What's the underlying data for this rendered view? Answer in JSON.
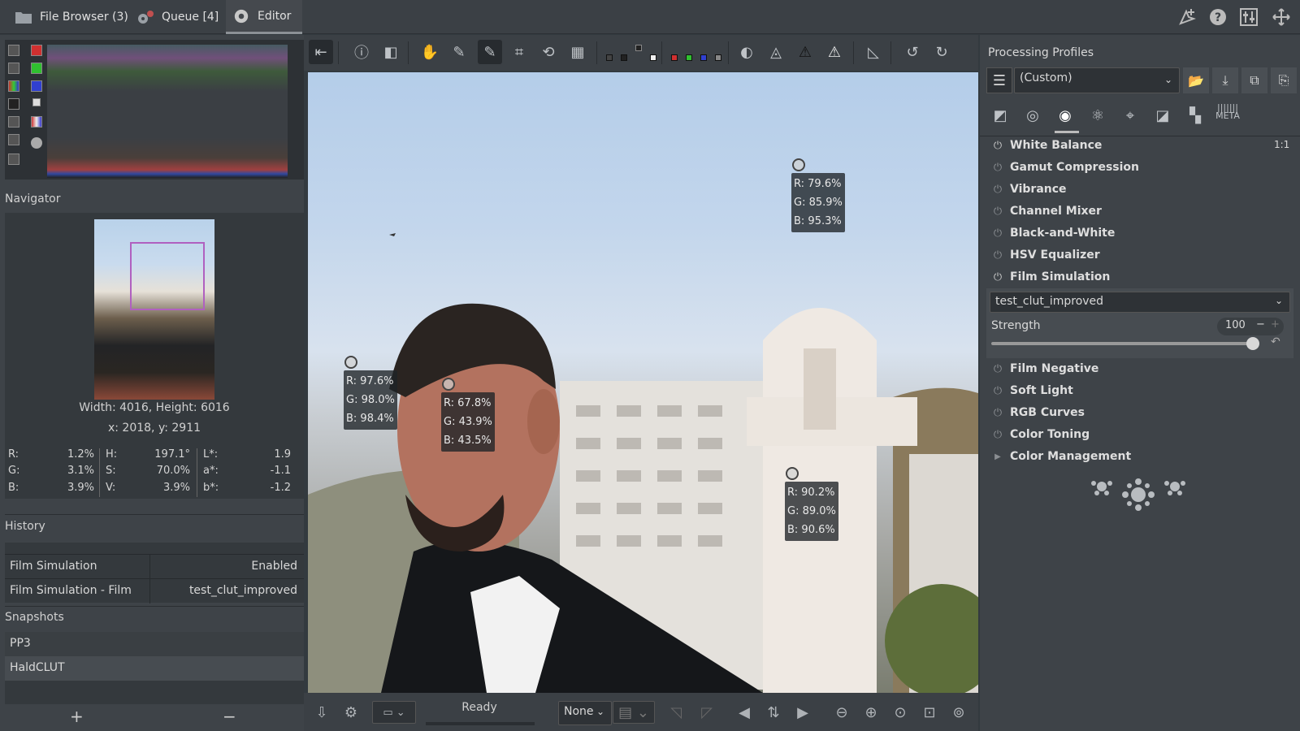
{
  "tabs": [
    {
      "label": "File Browser (3)"
    },
    {
      "label": "Queue [4]"
    },
    {
      "label": "Editor"
    }
  ],
  "navigator": {
    "title": "Navigator",
    "dims": "Width: 4016, Height: 6016",
    "coords": "x: 2018, y: 2911",
    "values": {
      "R": "1.2%",
      "G": "3.1%",
      "B": "3.9%",
      "H": "197.1°",
      "S": "70.0%",
      "V": "3.9%",
      "L": "1.9",
      "a": "-1.1",
      "b": "-1.2",
      "labels": {
        "R": "R:",
        "G": "G:",
        "B": "B:",
        "H": "H:",
        "S": "S:",
        "V": "V:",
        "L": "L*:",
        "a": "a*:",
        "b": "b*:"
      }
    }
  },
  "history": {
    "title": "History",
    "rows": [
      {
        "name": "Film Simulation",
        "value": "Enabled"
      },
      {
        "name": "Film Simulation - Film",
        "value": "test_clut_improved"
      }
    ]
  },
  "snapshots": {
    "title": "Snapshots",
    "rows": [
      "PP3",
      "HaldCLUT"
    ],
    "add": "+",
    "remove": "−"
  },
  "pickers": [
    {
      "r": "R: 79.6%",
      "g": "G: 85.9%",
      "b": "B: 95.3%"
    },
    {
      "r": "R: 97.6%",
      "g": "G: 98.0%",
      "b": "B: 98.4%"
    },
    {
      "r": "R: 67.8%",
      "g": "G: 43.9%",
      "b": "B: 43.5%"
    },
    {
      "r": "R: 90.2%",
      "g": "G: 89.0%",
      "b": "B: 90.6%"
    }
  ],
  "bottom": {
    "status": "Ready",
    "zoom_select": "None"
  },
  "right": {
    "title": "Processing Profiles",
    "profile": "(Custom)",
    "scale": "1:1",
    "modules": [
      "White Balance",
      "Gamut Compression",
      "Vibrance",
      "Channel Mixer",
      "Black-and-White",
      "HSV Equalizer",
      "Film Simulation",
      "Film Negative",
      "Soft Light",
      "RGB Curves",
      "Color Toning",
      "Color Management"
    ],
    "film": {
      "clut": "test_clut_improved",
      "strength_label": "Strength",
      "strength": "100",
      "strength_fraction": 1.0
    },
    "meta_label": "META"
  }
}
